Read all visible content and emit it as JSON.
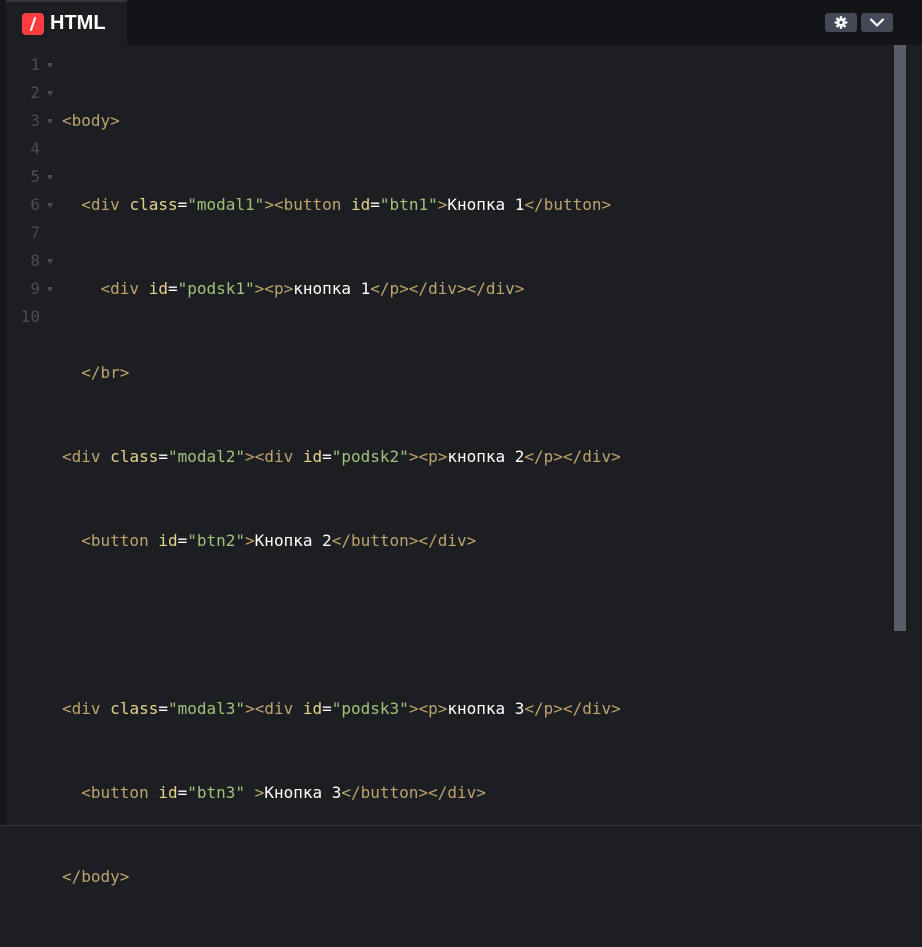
{
  "tab": {
    "title": "HTML",
    "icon": "slash-logo-icon"
  },
  "toolbar": {
    "settings_icon": "gear-icon",
    "collapse_icon": "chevron-down-icon"
  },
  "colors": {
    "background": "#1d1e22",
    "tag": "#bfa36e",
    "attr": "#e5d28b",
    "string": "#9ec27b",
    "text": "#ffffff",
    "accent": "#ff3c41"
  },
  "line_numbers": [
    "1",
    "2",
    "3",
    "4",
    "5",
    "6",
    "7",
    "8",
    "9",
    "10"
  ],
  "code": {
    "l1": {
      "t1": "<body>"
    },
    "l2": {
      "i": "  ",
      "t1": "<div ",
      "a1": "class",
      "e1": "=",
      "s1": "\"modal1\"",
      "t2": "><button ",
      "a2": "id",
      "e2": "=",
      "s2": "\"btn1\"",
      "t3": ">",
      "x1": "Кнопка 1",
      "t4": "</button>"
    },
    "l3": {
      "i": "    ",
      "t1": "<div ",
      "a1": "id",
      "e1": "=",
      "s1": "\"podsk1\"",
      "t2": "><p>",
      "x1": "кнопка 1",
      "t3": "</p></div></div>"
    },
    "l4": {
      "i": "  ",
      "t1": "</br>"
    },
    "l5": {
      "t1": "<div ",
      "a1": "class",
      "e1": "=",
      "s1": "\"modal2\"",
      "t2": "><div ",
      "a2": "id",
      "e2": "=",
      "s2": "\"podsk2\"",
      "t3": "><p>",
      "x1": "кнопка 2",
      "t4": "</p></div>"
    },
    "l6": {
      "i": "  ",
      "t1": "<button ",
      "a1": "id",
      "e1": "=",
      "s1": "\"btn2\"",
      "t2": ">",
      "x1": "Кнопка 2",
      "t3": "</button></div>"
    },
    "l7": {
      "t1": ""
    },
    "l8": {
      "t1": "<div ",
      "a1": "class",
      "e1": "=",
      "s1": "\"modal3\"",
      "t2": "><div ",
      "a2": "id",
      "e2": "=",
      "s2": "\"podsk3\"",
      "t3": "><p>",
      "x1": "кнопка 3",
      "t4": "</p></div>"
    },
    "l9": {
      "i": "  ",
      "t1": "<button ",
      "a1": "id",
      "e1": "=",
      "s1": "\"btn3\"",
      "sp": " ",
      "t2": ">",
      "x1": "Кнопка 3",
      "t3": "</button></div>"
    },
    "l10": {
      "t1": "</body>"
    }
  }
}
